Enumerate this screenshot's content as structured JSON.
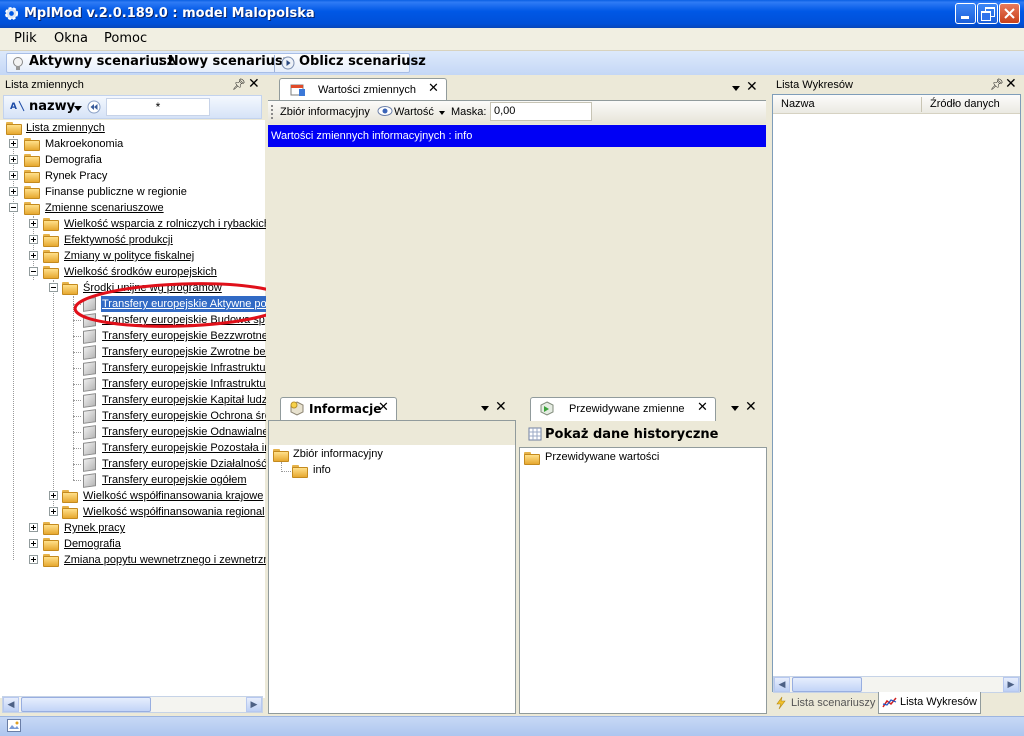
{
  "window": {
    "title": "MplMod v.2.0.189.0 : model Malopolska"
  },
  "menu": [
    "Plik",
    "Okna",
    "Pomoc"
  ],
  "toolbar": {
    "active_label": "Aktywny scenariusz",
    "new_label": ": Nowy scenariusz",
    "compute_label": "Oblicz scenariusz"
  },
  "left_panel": {
    "title": "Lista zmiennych",
    "sort_label": "nazwy",
    "filter_value": "*",
    "root": "Lista zmiennych",
    "items": [
      "Makroekonomia",
      "Demografia",
      "Rynek Pracy",
      "Finanse publiczne w regionie",
      "Zmienne scenariuszowe",
      "Wielkość wsparcia z rolniczych i rybackich",
      "Efektywność produkcji",
      "Zmiany w polityce fiskalnej",
      "Wielkość środków europejskich",
      "Środki unijne wg programów",
      "Transfery europejskie Aktywne po",
      "Transfery europejskie Budowa sp",
      "Transfery europejskie Bezzwrotne",
      "Transfery europejskie Zwrotne be:",
      "Transfery europejskie Infrastruktur",
      "Transfery europejskie Infrastruktur",
      "Transfery europejskie Kapitał ludz",
      "Transfery europejskie Ochrona śro",
      "Transfery europejskie Odnawialne",
      "Transfery europejskie Pozostała in",
      "Transfery europejskie Działalność",
      "Transfery europejskie ogółem",
      "Wielkość współfinansowania krajowe",
      "Wielkość współfinansowania regional",
      "Rynek pracy",
      "Demografia",
      "Zmiana popytu wewnetrznego i zewnetrzn"
    ]
  },
  "values_panel": {
    "tab": "Wartości zmiennych",
    "dataset_label": "Zbiór informacyjny",
    "value_label": "Wartość",
    "mask_label": "Maska:",
    "mask_value": "0,00",
    "header": "Wartości zmiennych informacyjnych : info"
  },
  "info_panel": {
    "tab": "Informacje",
    "root": "Zbiór informacyjny",
    "child": "info"
  },
  "forecast_panel": {
    "tab": "Przewidywane zmienne",
    "button": "Pokaż dane historyczne",
    "item": "Przewidywane wartości"
  },
  "charts_panel": {
    "title": "Lista Wykresów",
    "col_name": "Nazwa",
    "col_source": "Źródło danych",
    "tab_scenarios": "Lista scenariuszy",
    "tab_charts": "Lista Wykresów"
  }
}
